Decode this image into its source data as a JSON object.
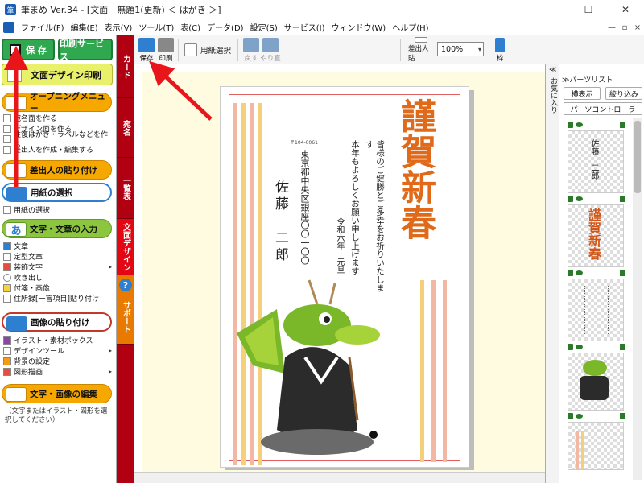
{
  "window": {
    "title": "筆まめ Ver.34 - [文面　無題1(更新) ＜ はがき ＞]",
    "controls": [
      "—",
      "☐",
      "✕"
    ]
  },
  "menubar": {
    "items": [
      "ファイル(F)",
      "編集(E)",
      "表示(V)",
      "ツール(T)",
      "表(C)",
      "データ(D)",
      "設定(S)",
      "サービス(I)",
      "ウィンドウ(W)",
      "ヘルプ(H)"
    ],
    "mdi_controls": [
      "—",
      "▫",
      "×"
    ]
  },
  "leftpanel": {
    "save_label": "保 存",
    "print_service_label": "印刷サービス",
    "design_print_label": "文面デザイン印刷",
    "opening_menu": {
      "label": "オープニングメニュー",
      "items": [
        {
          "label": "宛名面を作る"
        },
        {
          "label": "デザイン面を作る"
        },
        {
          "label": "往復はがき・ラベルなどを作る"
        },
        {
          "label": "差出人を作成・編集する"
        }
      ]
    },
    "sender_paste_label": "差出人の貼り付け",
    "paper_select": {
      "label": "用紙の選択",
      "items": [
        {
          "label": "用紙の選択"
        }
      ]
    },
    "text_input": {
      "icon_char": "あ",
      "label": "文字・文章の入力",
      "items": [
        {
          "label": "文章",
          "arrow": ""
        },
        {
          "label": "定型文章",
          "arrow": ""
        },
        {
          "label": "装飾文字",
          "arrow": "▸"
        },
        {
          "label": "吹き出し",
          "arrow": ""
        },
        {
          "label": "付箋・画像",
          "arrow": ""
        },
        {
          "label": "住所録[一言項目]貼り付け",
          "arrow": ""
        }
      ]
    },
    "image_paste": {
      "label": "画像の貼り付け",
      "items": [
        {
          "label": "イラスト・素材ボックス",
          "arrow": ""
        },
        {
          "label": "デザインツール",
          "arrow": "▸"
        },
        {
          "label": "背景の設定",
          "arrow": ""
        },
        {
          "label": "図形描画",
          "arrow": "▸"
        }
      ]
    },
    "edit": {
      "label": "文字・画像の編集",
      "hint": "（文字またはイラスト・図形を選択してください）"
    }
  },
  "sidetabs": {
    "tabs": [
      "カード",
      "宛名",
      "一覧表",
      "文面デザイン",
      "サポート"
    ],
    "help_char": "?"
  },
  "toolbar": {
    "save_label": "保存",
    "print_label": "印刷",
    "paper_select_label": "用紙選択",
    "undo_label": "戻す",
    "redo_label": "やり直",
    "sender_paste_label": "差出人貼",
    "zoom_value": "100%",
    "frame_label": "枠"
  },
  "card": {
    "postal_code": "〒104-0061",
    "address": "東京都中央区銀座〇〇一〇〇",
    "recipient_name": "佐藤　二郎",
    "greeting_lines": [
      "皆様のご健勝とご多幸をお祈りいたします",
      "本年もよろしくお願い申し上げます"
    ],
    "date": "令和六年　元旦",
    "big_kanji": "謹賀新春"
  },
  "rightpanel": {
    "fav_tab_chevron": "≪",
    "fav_tab_label": "お気に入り",
    "parts_list_label": "≫パーツリスト",
    "horizontal_view_label": "横表示",
    "filter_label": "絞り込み",
    "parts_controller_label": "パーツコントローラ",
    "thumb1_text": "佐藤　二郎",
    "thumb2_text": "謹賀新春"
  },
  "colors": {
    "accent_red": "#b00012",
    "annotation_arrow": "#e8161b",
    "save_green": "#2fa84f",
    "workspace_bg": "#fffbe0"
  }
}
